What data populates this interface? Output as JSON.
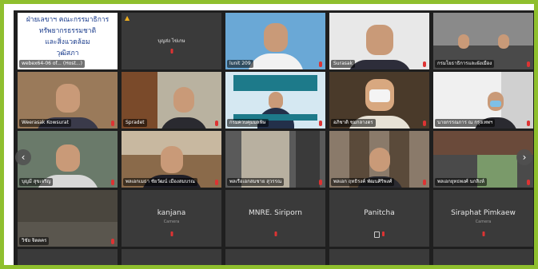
{
  "tiles": [
    {
      "label": "webex64-06 of... (Host...)",
      "slide_lines": [
        "ฝ่ายเลขาฯ คณะกรรมาธิการ",
        "ทรัพยากรธรรมชาติ",
        "และสิ่งแวดล้อม",
        "วุฒิสภา"
      ]
    },
    {
      "label": "บุญส่ง ไข่เกษ",
      "warning": "▲"
    },
    {
      "label": "lunit 209"
    },
    {
      "label": "Surasak"
    },
    {
      "label": "กรมโยธาธิการและผังเมือง"
    },
    {
      "label": "Weerasak Kowsurat"
    },
    {
      "label": "Spradet"
    },
    {
      "label": "กรมควบคุมมลพิษ"
    },
    {
      "label": "อภิชาติ ชมกลางตร"
    },
    {
      "label": "นายกรรณการ ณ กรุงเทพฯ"
    },
    {
      "label": "บุญมี สุขเจริญ"
    },
    {
      "label": "พลเอกเมธา ชัยวัฒน์ เมืองสมบรณ"
    },
    {
      "label": "พลเรือเอกสมชาย สุวรรณ"
    },
    {
      "label": "พลเอก ฤทธิรงค์ พัฒนศิริพงศ์"
    },
    {
      "label": "พลเอกยุทธพงศ์ นกสิงห์"
    },
    {
      "label": "วิชัย จิตตคร"
    },
    {
      "name": "kanjana",
      "sub": "Camera"
    },
    {
      "name": "MNRE. Siriporn"
    },
    {
      "name": "Panitcha"
    },
    {
      "name": "Siraphat Pimkaew",
      "sub": "Camera"
    }
  ],
  "nav": {
    "prev": "‹",
    "next": "›"
  },
  "colors": {
    "border": "#8fbf2e",
    "bg": "#1f1f1f",
    "tile": "#3a3a3a"
  }
}
